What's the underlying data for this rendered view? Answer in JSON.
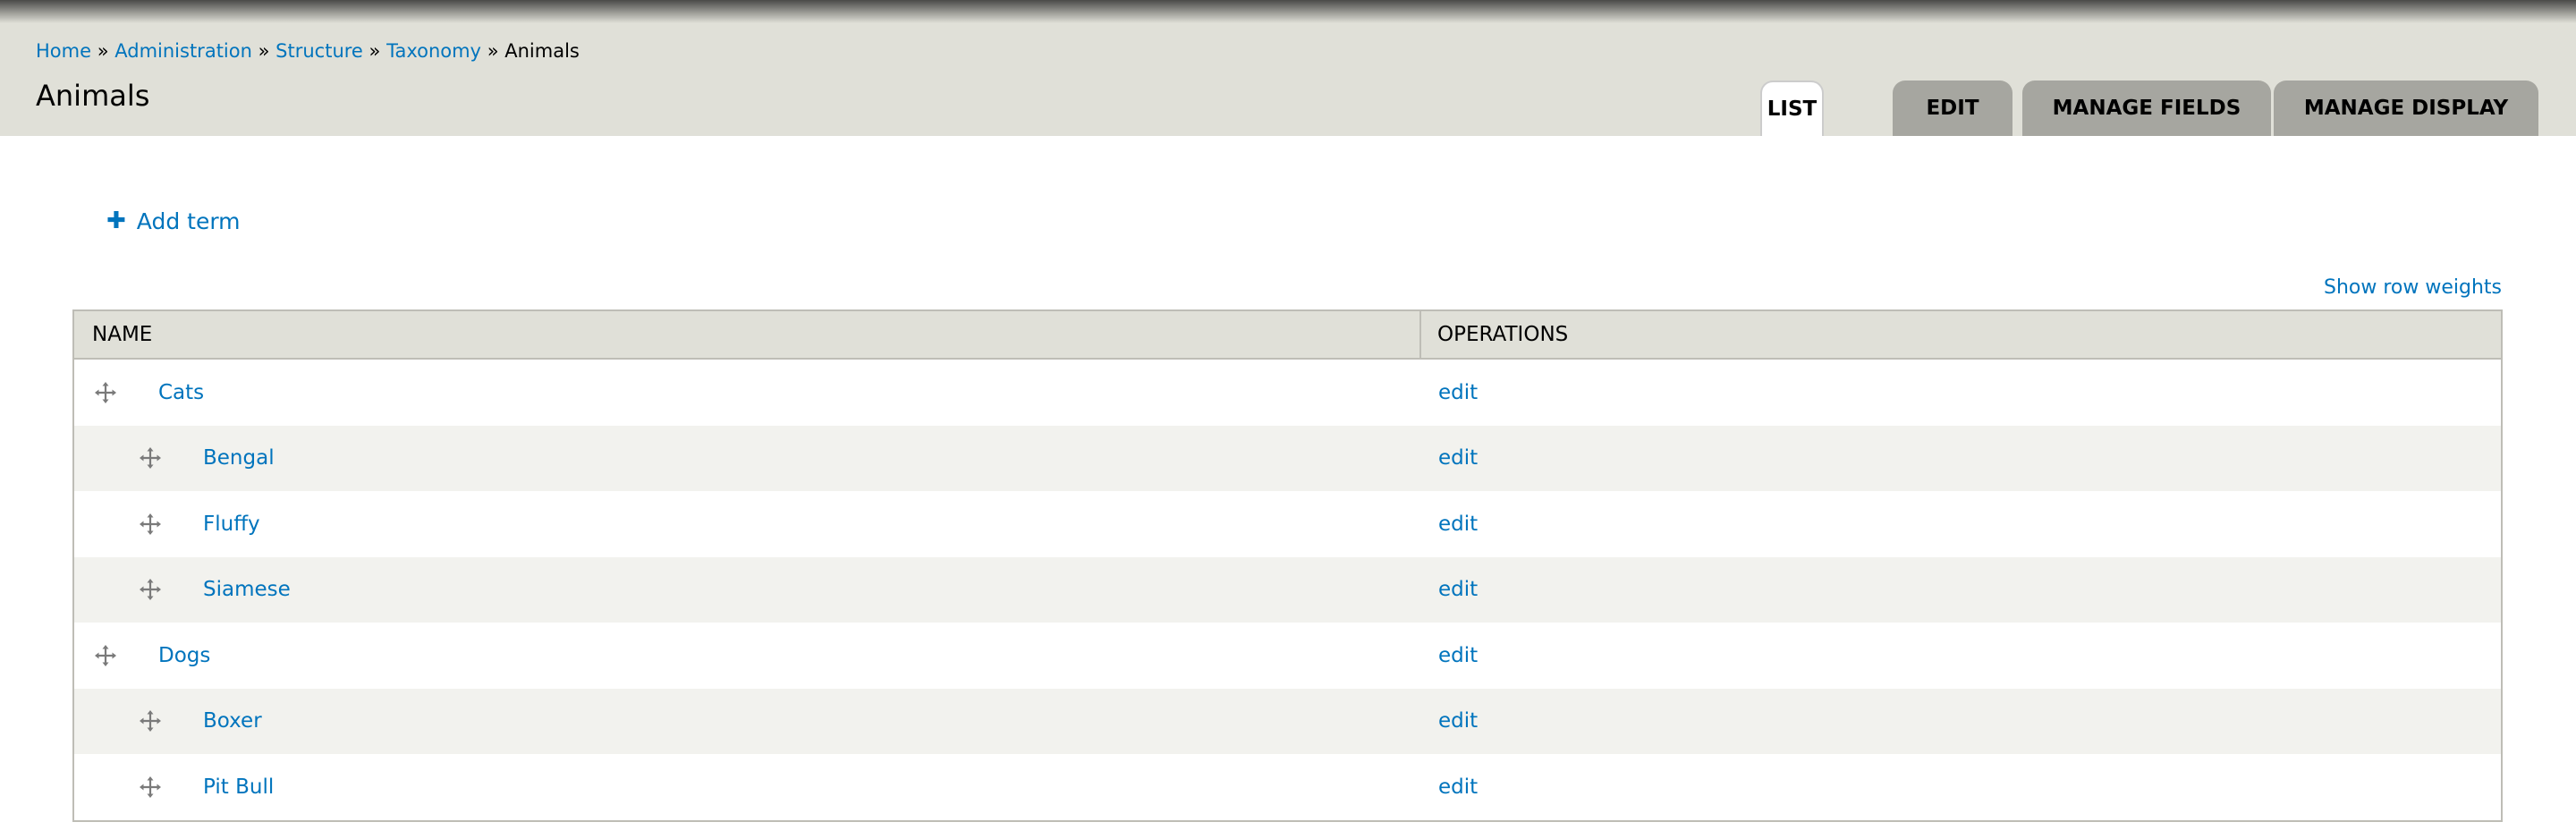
{
  "breadcrumb": {
    "items": [
      {
        "label": "Home"
      },
      {
        "label": "Administration"
      },
      {
        "label": "Structure"
      },
      {
        "label": "Taxonomy"
      }
    ],
    "separator": "»",
    "current": "Animals"
  },
  "page_title": "Animals",
  "tabs": [
    {
      "label": "LIST",
      "active": true
    },
    {
      "label": "EDIT"
    },
    {
      "label": "MANAGE FIELDS"
    },
    {
      "label": "MANAGE DISPLAY"
    }
  ],
  "actions": {
    "add_term_icon": "plus-icon",
    "add_term": "Add term",
    "show_row_weights": "Show row weights"
  },
  "table": {
    "columns": [
      "NAME",
      "OPERATIONS"
    ],
    "rows": [
      {
        "name": "Cats",
        "depth": 0,
        "operation": "edit"
      },
      {
        "name": "Bengal",
        "depth": 1,
        "operation": "edit"
      },
      {
        "name": "Fluffy",
        "depth": 1,
        "operation": "edit"
      },
      {
        "name": "Siamese",
        "depth": 1,
        "operation": "edit"
      },
      {
        "name": "Dogs",
        "depth": 0,
        "operation": "edit"
      },
      {
        "name": "Boxer",
        "depth": 1,
        "operation": "edit"
      },
      {
        "name": "Pit Bull",
        "depth": 1,
        "operation": "edit"
      }
    ]
  },
  "colors": {
    "link": "#0074bd",
    "header_bg": "#e0e0d8",
    "tab_inactive": "#a6a6a0",
    "row_alt": "#f2f2ee"
  }
}
